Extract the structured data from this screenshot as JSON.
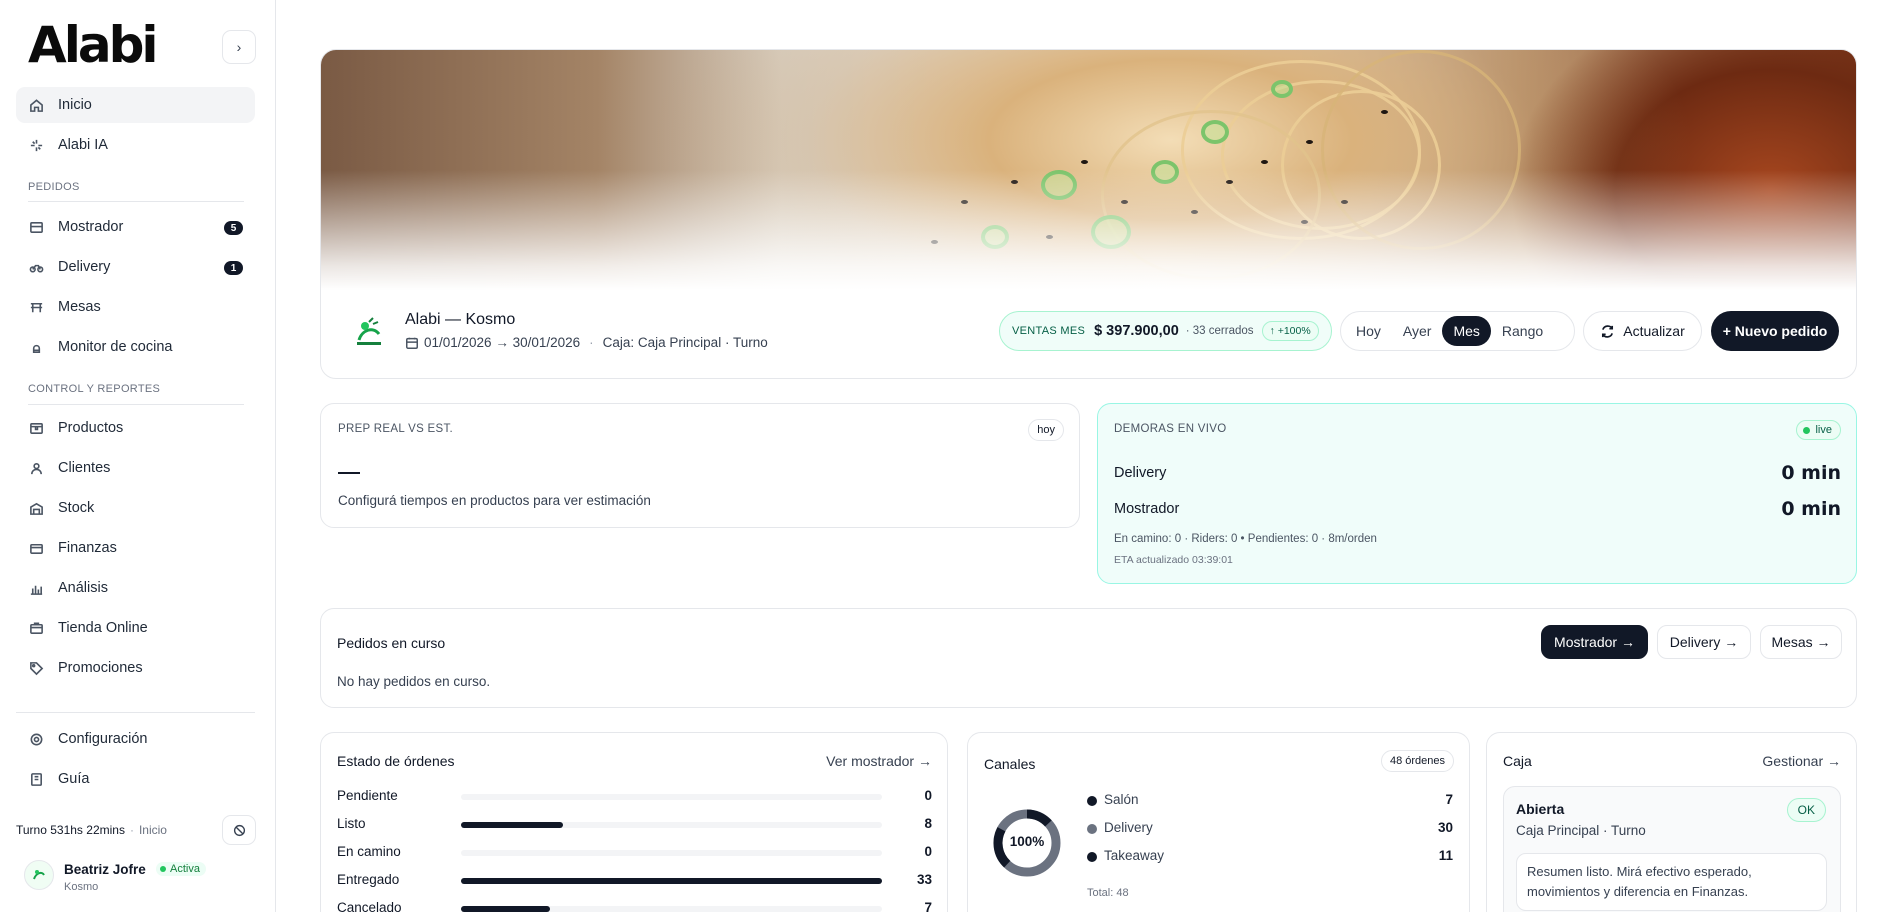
{
  "brand": {
    "logo": "Alabi"
  },
  "sidebar": {
    "items_top": [
      {
        "label": "Inicio",
        "icon": "home-icon",
        "active": true
      },
      {
        "label": "Alabi IA",
        "icon": "sparkles-icon"
      }
    ],
    "section_pedidos": "PEDIDOS",
    "items_pedidos": [
      {
        "label": "Mostrador",
        "icon": "store-icon",
        "badge": "5"
      },
      {
        "label": "Delivery",
        "icon": "bike-icon",
        "badge": "1"
      },
      {
        "label": "Mesas",
        "icon": "table-icon"
      },
      {
        "label": "Monitor de cocina",
        "icon": "chef-hat-icon"
      }
    ],
    "section_control": "CONTROL Y REPORTES",
    "items_control": [
      {
        "label": "Productos",
        "icon": "package-icon"
      },
      {
        "label": "Clientes",
        "icon": "user-icon"
      },
      {
        "label": "Stock",
        "icon": "warehouse-icon"
      },
      {
        "label": "Finanzas",
        "icon": "wallet-icon"
      },
      {
        "label": "Análisis",
        "icon": "bar-chart-icon"
      },
      {
        "label": "Tienda Online",
        "icon": "shop-icon"
      },
      {
        "label": "Promociones",
        "icon": "tag-icon"
      }
    ],
    "items_bottom": [
      {
        "label": "Configuración",
        "icon": "settings-icon"
      },
      {
        "label": "Guía",
        "icon": "book-icon"
      }
    ],
    "turno": {
      "duration": "Turno 531hs 22mins",
      "location": "Inicio"
    },
    "user": {
      "name": "Beatriz Jofre",
      "status": "Activa",
      "org": "Kosmo"
    }
  },
  "header": {
    "store_name": "Alabi — Kosmo",
    "date_range": "01/01/2026 → 30/01/2026",
    "caja": "Caja: Caja Principal · Turno",
    "sales": {
      "label": "VENTAS MES",
      "value": "$ 397.900,00",
      "closed": "· 33 cerrados",
      "trend": "↑ +100%"
    },
    "ranges": [
      "Hoy",
      "Ayer",
      "Mes",
      "Rango"
    ],
    "active_range": "Mes",
    "refresh_label": "Actualizar",
    "new_order_label": "+ Nuevo pedido"
  },
  "prep": {
    "title": "PREP REAL VS EST.",
    "chip": "hoy",
    "value": "—",
    "hint": "Configurá tiempos en productos para ver estimación"
  },
  "delays": {
    "title": "DEMORAS EN VIVO",
    "chip": "live",
    "rows": [
      {
        "label": "Delivery",
        "value": "0 min"
      },
      {
        "label": "Mostrador",
        "value": "0 min"
      }
    ],
    "detail": "En camino: 0 · Riders: 0 • Pendientes: 0 · 8m/orden",
    "eta": "ETA actualizado 03:39:01"
  },
  "orders": {
    "title": "Pedidos en curso",
    "empty": "No hay pedidos en curso.",
    "buttons": [
      "Mostrador →",
      "Delivery →",
      "Mesas →"
    ]
  },
  "status": {
    "title": "Estado de órdenes",
    "link": "Ver mostrador →",
    "max": 33,
    "rows": [
      {
        "label": "Pendiente",
        "count": 0
      },
      {
        "label": "Listo",
        "count": 8
      },
      {
        "label": "En camino",
        "count": 0
      },
      {
        "label": "Entregado",
        "count": 33
      },
      {
        "label": "Cancelado",
        "count": 7
      }
    ]
  },
  "channels": {
    "title": "Canales",
    "chip": "48 órdenes",
    "donut_label": "100%",
    "rows": [
      {
        "label": "Salón",
        "value": "7",
        "color": "#111827"
      },
      {
        "label": "Delivery",
        "value": "30",
        "color": "#6b7280"
      },
      {
        "label": "Takeaway",
        "value": "11",
        "color": "#111827"
      }
    ],
    "total": "Total: 48"
  },
  "cash": {
    "title": "Caja",
    "link": "Gestionar →",
    "status": "Abierta",
    "ok": "OK",
    "sub": "Caja Principal · Turno",
    "note": "Resumen listo. Mirá efectivo esperado, movimientos y diferencia en Finanzas."
  },
  "colors": {
    "accent": "#111827",
    "success": "#22c55e",
    "success_bg": "#ecfdf5",
    "live_bg": "#f0fdfa"
  }
}
